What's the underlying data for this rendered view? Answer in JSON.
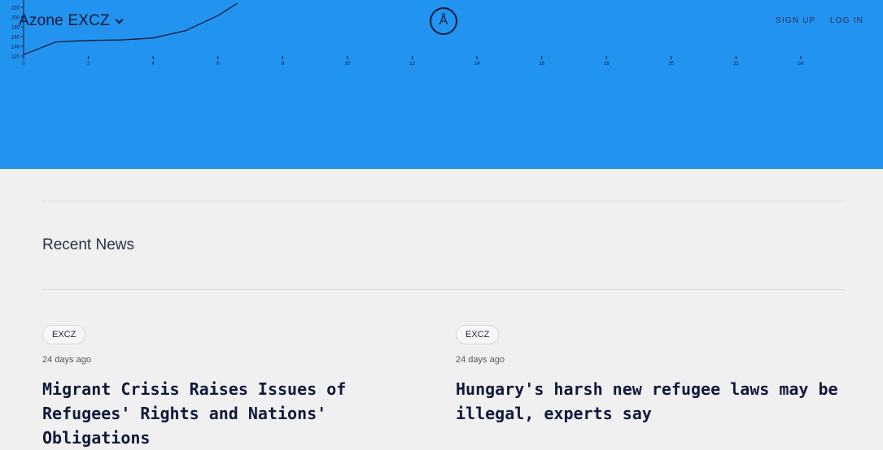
{
  "header": {
    "brand": "Azone EXCZ",
    "logo_glyph": "Å",
    "nav": [
      "SIGN UP",
      "LOG IN"
    ],
    "accent_color": "#2293ee"
  },
  "chart_data": {
    "type": "line",
    "title": "",
    "xlabel": "",
    "ylabel": "",
    "xticks": [
      "0",
      "2",
      "4",
      "6",
      "8",
      "10",
      "12",
      "14",
      "16",
      "18",
      "20",
      "22",
      "24"
    ],
    "yticks": [
      "120",
      "140",
      "160",
      "180",
      "200",
      "220"
    ],
    "xlim": [
      0,
      24
    ],
    "ylim": [
      120,
      220
    ],
    "series": [
      {
        "x": [
          0,
          1,
          2,
          3,
          4,
          5,
          6,
          6.6
        ],
        "y": [
          123,
          149,
          152,
          153,
          157,
          172,
          203,
          228
        ]
      }
    ]
  },
  "news": {
    "title": "Recent News",
    "articles": [
      {
        "tag": "EXCZ",
        "time": "24 days ago",
        "headline": "Migrant Crisis Raises Issues of Refugees' Rights and Nations' Obligations"
      },
      {
        "tag": "EXCZ",
        "time": "24 days ago",
        "headline": "Hungary's harsh new refugee laws may be illegal, experts say"
      }
    ]
  }
}
